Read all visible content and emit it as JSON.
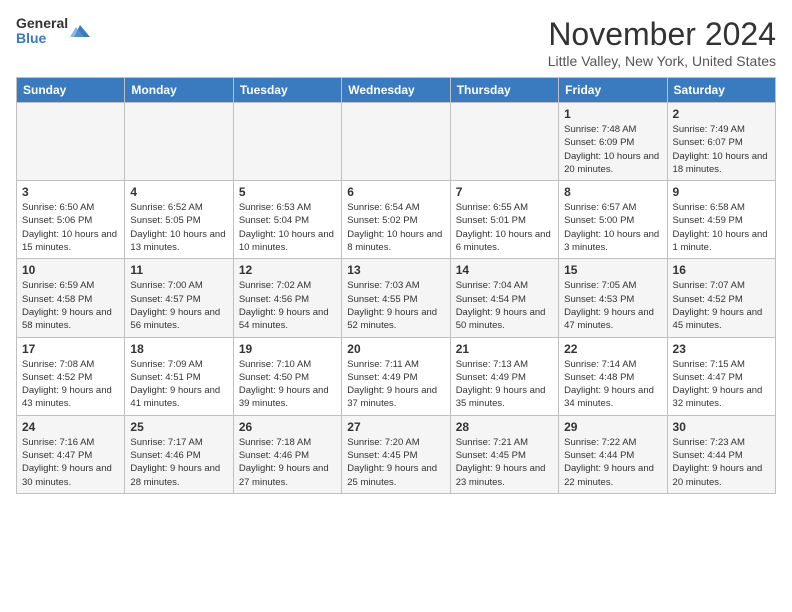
{
  "header": {
    "logo_general": "General",
    "logo_blue": "Blue",
    "month_title": "November 2024",
    "location": "Little Valley, New York, United States"
  },
  "days_of_week": [
    "Sunday",
    "Monday",
    "Tuesday",
    "Wednesday",
    "Thursday",
    "Friday",
    "Saturday"
  ],
  "weeks": [
    [
      {
        "day": "",
        "info": ""
      },
      {
        "day": "",
        "info": ""
      },
      {
        "day": "",
        "info": ""
      },
      {
        "day": "",
        "info": ""
      },
      {
        "day": "",
        "info": ""
      },
      {
        "day": "1",
        "info": "Sunrise: 7:48 AM\nSunset: 6:09 PM\nDaylight: 10 hours and 20 minutes."
      },
      {
        "day": "2",
        "info": "Sunrise: 7:49 AM\nSunset: 6:07 PM\nDaylight: 10 hours and 18 minutes."
      }
    ],
    [
      {
        "day": "3",
        "info": "Sunrise: 6:50 AM\nSunset: 5:06 PM\nDaylight: 10 hours and 15 minutes."
      },
      {
        "day": "4",
        "info": "Sunrise: 6:52 AM\nSunset: 5:05 PM\nDaylight: 10 hours and 13 minutes."
      },
      {
        "day": "5",
        "info": "Sunrise: 6:53 AM\nSunset: 5:04 PM\nDaylight: 10 hours and 10 minutes."
      },
      {
        "day": "6",
        "info": "Sunrise: 6:54 AM\nSunset: 5:02 PM\nDaylight: 10 hours and 8 minutes."
      },
      {
        "day": "7",
        "info": "Sunrise: 6:55 AM\nSunset: 5:01 PM\nDaylight: 10 hours and 6 minutes."
      },
      {
        "day": "8",
        "info": "Sunrise: 6:57 AM\nSunset: 5:00 PM\nDaylight: 10 hours and 3 minutes."
      },
      {
        "day": "9",
        "info": "Sunrise: 6:58 AM\nSunset: 4:59 PM\nDaylight: 10 hours and 1 minute."
      }
    ],
    [
      {
        "day": "10",
        "info": "Sunrise: 6:59 AM\nSunset: 4:58 PM\nDaylight: 9 hours and 58 minutes."
      },
      {
        "day": "11",
        "info": "Sunrise: 7:00 AM\nSunset: 4:57 PM\nDaylight: 9 hours and 56 minutes."
      },
      {
        "day": "12",
        "info": "Sunrise: 7:02 AM\nSunset: 4:56 PM\nDaylight: 9 hours and 54 minutes."
      },
      {
        "day": "13",
        "info": "Sunrise: 7:03 AM\nSunset: 4:55 PM\nDaylight: 9 hours and 52 minutes."
      },
      {
        "day": "14",
        "info": "Sunrise: 7:04 AM\nSunset: 4:54 PM\nDaylight: 9 hours and 50 minutes."
      },
      {
        "day": "15",
        "info": "Sunrise: 7:05 AM\nSunset: 4:53 PM\nDaylight: 9 hours and 47 minutes."
      },
      {
        "day": "16",
        "info": "Sunrise: 7:07 AM\nSunset: 4:52 PM\nDaylight: 9 hours and 45 minutes."
      }
    ],
    [
      {
        "day": "17",
        "info": "Sunrise: 7:08 AM\nSunset: 4:52 PM\nDaylight: 9 hours and 43 minutes."
      },
      {
        "day": "18",
        "info": "Sunrise: 7:09 AM\nSunset: 4:51 PM\nDaylight: 9 hours and 41 minutes."
      },
      {
        "day": "19",
        "info": "Sunrise: 7:10 AM\nSunset: 4:50 PM\nDaylight: 9 hours and 39 minutes."
      },
      {
        "day": "20",
        "info": "Sunrise: 7:11 AM\nSunset: 4:49 PM\nDaylight: 9 hours and 37 minutes."
      },
      {
        "day": "21",
        "info": "Sunrise: 7:13 AM\nSunset: 4:49 PM\nDaylight: 9 hours and 35 minutes."
      },
      {
        "day": "22",
        "info": "Sunrise: 7:14 AM\nSunset: 4:48 PM\nDaylight: 9 hours and 34 minutes."
      },
      {
        "day": "23",
        "info": "Sunrise: 7:15 AM\nSunset: 4:47 PM\nDaylight: 9 hours and 32 minutes."
      }
    ],
    [
      {
        "day": "24",
        "info": "Sunrise: 7:16 AM\nSunset: 4:47 PM\nDaylight: 9 hours and 30 minutes."
      },
      {
        "day": "25",
        "info": "Sunrise: 7:17 AM\nSunset: 4:46 PM\nDaylight: 9 hours and 28 minutes."
      },
      {
        "day": "26",
        "info": "Sunrise: 7:18 AM\nSunset: 4:46 PM\nDaylight: 9 hours and 27 minutes."
      },
      {
        "day": "27",
        "info": "Sunrise: 7:20 AM\nSunset: 4:45 PM\nDaylight: 9 hours and 25 minutes."
      },
      {
        "day": "28",
        "info": "Sunrise: 7:21 AM\nSunset: 4:45 PM\nDaylight: 9 hours and 23 minutes."
      },
      {
        "day": "29",
        "info": "Sunrise: 7:22 AM\nSunset: 4:44 PM\nDaylight: 9 hours and 22 minutes."
      },
      {
        "day": "30",
        "info": "Sunrise: 7:23 AM\nSunset: 4:44 PM\nDaylight: 9 hours and 20 minutes."
      }
    ]
  ]
}
